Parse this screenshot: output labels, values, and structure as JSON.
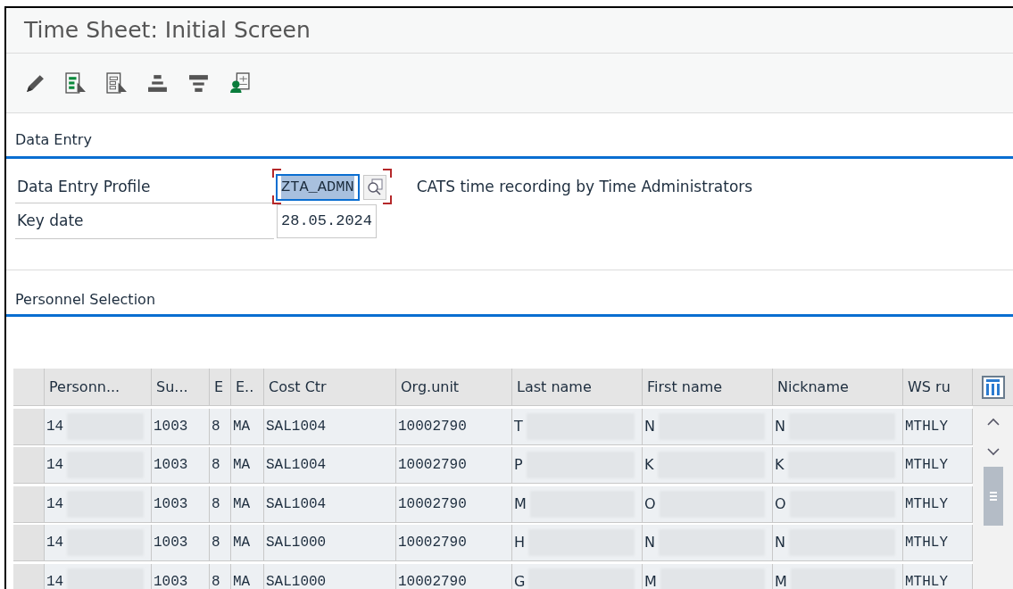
{
  "window": {
    "title": "Time Sheet: Initial Screen"
  },
  "toolbar": [
    {
      "kind": "edit"
    },
    {
      "kind": "select-green"
    },
    {
      "kind": "select-grey"
    },
    {
      "kind": "stack-up"
    },
    {
      "kind": "stack-down"
    },
    {
      "kind": "person-doc"
    }
  ],
  "data_entry": {
    "title": "Data Entry",
    "fields": [
      {
        "label": "Data Entry Profile",
        "value": "ZTA_ADMN",
        "focused": true,
        "search_help": true,
        "description": "CATS time recording by Time Administrators"
      },
      {
        "label": "Key date",
        "value": "28.05.2024",
        "focused": false,
        "search_help": false
      }
    ]
  },
  "personnel_selection": {
    "title": "Personnel Selection",
    "table": {
      "columns": [
        {
          "label": "Personn...",
          "kind": "code",
          "redacted": true
        },
        {
          "label": "Su...",
          "kind": "code",
          "redacted": false
        },
        {
          "label": "E",
          "kind": "code",
          "redacted": false
        },
        {
          "label": "E..",
          "kind": "code",
          "redacted": false
        },
        {
          "label": "Cost Ctr",
          "kind": "code",
          "redacted": false
        },
        {
          "label": "Org.unit",
          "kind": "code",
          "redacted": false
        },
        {
          "label": "Last name",
          "kind": "text",
          "redacted": true
        },
        {
          "label": "First name",
          "kind": "text",
          "redacted": true
        },
        {
          "label": "Nickname",
          "kind": "text",
          "redacted": true
        },
        {
          "label": "WS ru",
          "kind": "code",
          "redacted": false
        }
      ],
      "rows": [
        {
          "cells": [
            "14",
            "1003",
            "8",
            "MA",
            "SAL1004",
            "10002790",
            "T",
            "N",
            "N",
            "MTHLY"
          ]
        },
        {
          "cells": [
            "14",
            "1003",
            "8",
            "MA",
            "SAL1004",
            "10002790",
            "P",
            "K",
            "K",
            "MTHLY"
          ]
        },
        {
          "cells": [
            "14",
            "1003",
            "8",
            "MA",
            "SAL1004",
            "10002790",
            "M",
            "O",
            "O",
            "MTHLY"
          ]
        },
        {
          "cells": [
            "14",
            "1003",
            "8",
            "MA",
            "SAL1000",
            "10002790",
            "H",
            "N",
            "N",
            "MTHLY"
          ]
        },
        {
          "cells": [
            "14",
            "1003",
            "8",
            "MA",
            "SAL1000",
            "10002790",
            "G",
            "M",
            "M",
            "MTHLY"
          ]
        }
      ]
    }
  }
}
